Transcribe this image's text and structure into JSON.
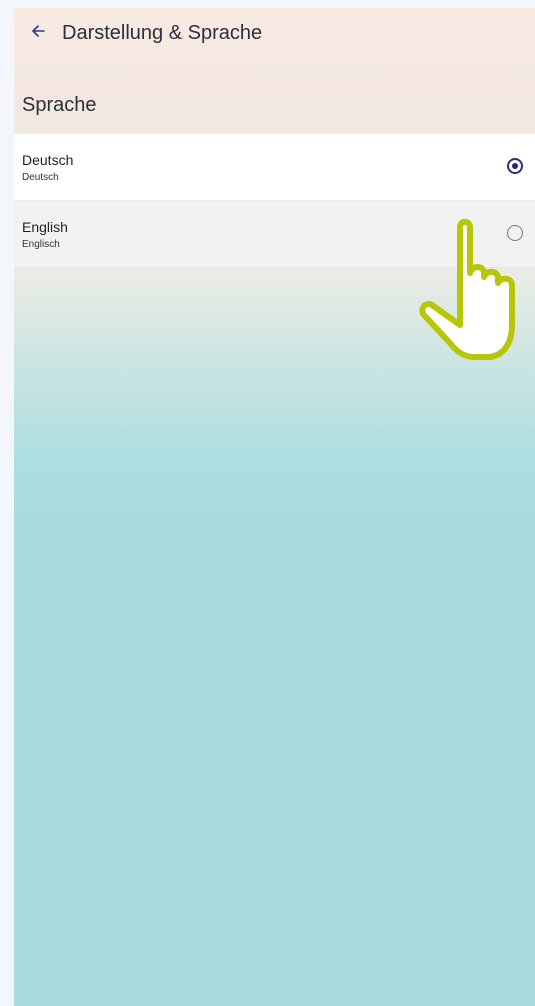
{
  "header": {
    "back_icon": "arrow-left-icon",
    "title": "Darstellung & Sprache"
  },
  "section": {
    "title": "Sprache"
  },
  "options": [
    {
      "label": "Deutsch",
      "sublabel": "Deutsch",
      "selected": true
    },
    {
      "label": "English",
      "sublabel": "Englisch",
      "selected": false
    }
  ],
  "colors": {
    "accent": "#1f2570",
    "pointer_outline": "#b8c60a"
  },
  "overlay": {
    "pointer_icon": "hand-pointer-icon"
  }
}
